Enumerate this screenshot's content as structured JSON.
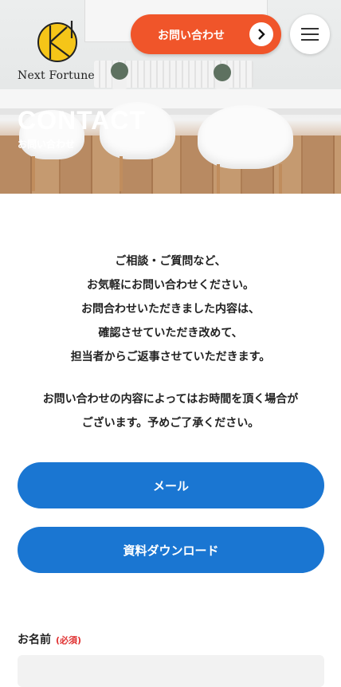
{
  "header": {
    "brand_name": "Next Fortune",
    "contact_button_label": "お問い合わせ",
    "contact_button_icon": "chevron-right-icon",
    "menu_icon": "hamburger-icon",
    "accent_color": "#f0552a"
  },
  "hero": {
    "title": "CONTACT",
    "subtitle": "お問い合わせ"
  },
  "intro": {
    "lines": [
      "ご相談・ご質問など、",
      "お気軽にお問い合わせください。",
      "お問合わせいただきました内容は、",
      "確認させていただき改めて、",
      "担当者からご返事させていただきます。"
    ]
  },
  "notice": {
    "lines": [
      "お問い合わせの内容によってはお時間を頂く場合が",
      "ございます。予めご了承ください。"
    ]
  },
  "buttons": {
    "mail_label": "メール",
    "download_label": "資料ダウンロード",
    "color": "#1a76d2"
  },
  "form": {
    "name_label": "お名前",
    "required_badge": "(必須)",
    "name_value": ""
  }
}
